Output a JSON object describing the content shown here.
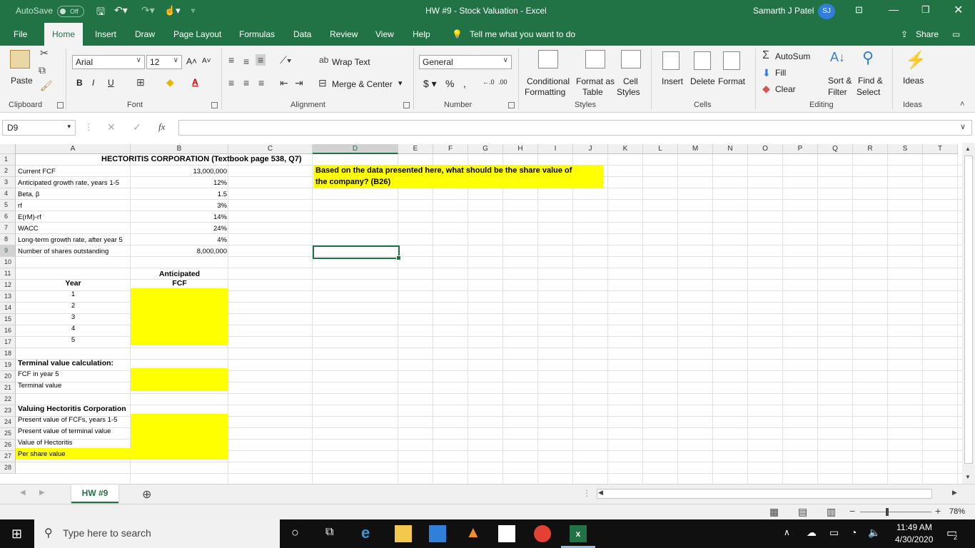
{
  "window": {
    "autosave_label": "AutoSave",
    "autosave_state": "Off",
    "title": "HW #9 - Stock Valuation  -  Excel",
    "user": "Samarth J Patel",
    "user_initials": "SJ"
  },
  "tabs": [
    "File",
    "Home",
    "Insert",
    "Draw",
    "Page Layout",
    "Formulas",
    "Data",
    "Review",
    "View",
    "Help"
  ],
  "tell_me": "Tell me what you want to do",
  "share_label": "Share",
  "ribbon": {
    "clipboard": {
      "paste": "Paste",
      "group": "Clipboard"
    },
    "font": {
      "name": "Arial",
      "size": "12",
      "bold": "B",
      "italic": "I",
      "underline": "U",
      "group": "Font"
    },
    "alignment": {
      "wrap": "Wrap Text",
      "merge": "Merge & Center",
      "group": "Alignment"
    },
    "number": {
      "format": "General",
      "group": "Number"
    },
    "styles": {
      "conditional": "Conditional",
      "conditional2": "Formatting",
      "format_as": "Format as",
      "format_as2": "Table",
      "cell": "Cell",
      "cell2": "Styles",
      "group": "Styles"
    },
    "cells": {
      "insert": "Insert",
      "delete": "Delete",
      "format": "Format",
      "group": "Cells"
    },
    "editing": {
      "autosum": "AutoSum",
      "fill": "Fill",
      "clear": "Clear",
      "sort": "Sort &",
      "sort2": "Filter",
      "find": "Find &",
      "find2": "Select",
      "group": "Editing"
    },
    "ideas": {
      "label": "Ideas",
      "group": "Ideas"
    }
  },
  "formula_bar": {
    "name_box": "D9",
    "fx": "fx",
    "formula": ""
  },
  "columns": [
    "A",
    "B",
    "C",
    "D",
    "E",
    "F",
    "G",
    "H",
    "I",
    "J",
    "K",
    "L",
    "M",
    "N",
    "O",
    "P",
    "Q",
    "R",
    "S",
    "T"
  ],
  "rows": [
    "1",
    "2",
    "3",
    "4",
    "5",
    "6",
    "7",
    "8",
    "9",
    "10",
    "11",
    "12",
    "13",
    "14",
    "15",
    "16",
    "17",
    "18",
    "19",
    "20",
    "21",
    "22",
    "23",
    "24",
    "25",
    "26",
    "27",
    "28"
  ],
  "sheet": {
    "title": "HECTORITIS CORPORATION (Textbook page 538, Q7)",
    "question": "Based on the data presented here, what should be the share value of",
    "question2": "the company? (B26)",
    "inputs": [
      {
        "label": "Current FCF",
        "value": "13,000,000"
      },
      {
        "label": "Anticipated growth rate, years 1-5",
        "value": "12%"
      },
      {
        "label": "Beta, β",
        "value": "1.5"
      },
      {
        "label": "rf",
        "value": "3%"
      },
      {
        "label": "E(rM)-rf",
        "value": "14%"
      },
      {
        "label": "WACC",
        "value": "24%"
      },
      {
        "label": "Long-term growth rate, after year 5",
        "value": "4%"
      },
      {
        "label": "Number of shares outstanding",
        "value": "8,000,000"
      }
    ],
    "year_header": "Year",
    "fcf_header": "Anticipated",
    "fcf_header2": "FCF",
    "years": [
      "1",
      "2",
      "3",
      "4",
      "5"
    ],
    "terminal_header": "Terminal value calculation:",
    "terminal_rows": [
      "FCF in year 5",
      "Terminal value"
    ],
    "valuing_header": "Valuing Hectoritis Corporation",
    "valuing_rows": [
      "Present value of FCFs, years 1-5",
      "Present value of terminal value",
      "Value of Hectoritis",
      "Per share value"
    ]
  },
  "sheet_tab": "HW #9",
  "status": {
    "zoom": "78%"
  },
  "taskbar": {
    "search_placeholder": "Type here to search",
    "time": "11:49 AM",
    "date": "4/30/2020",
    "notifications": "2"
  }
}
